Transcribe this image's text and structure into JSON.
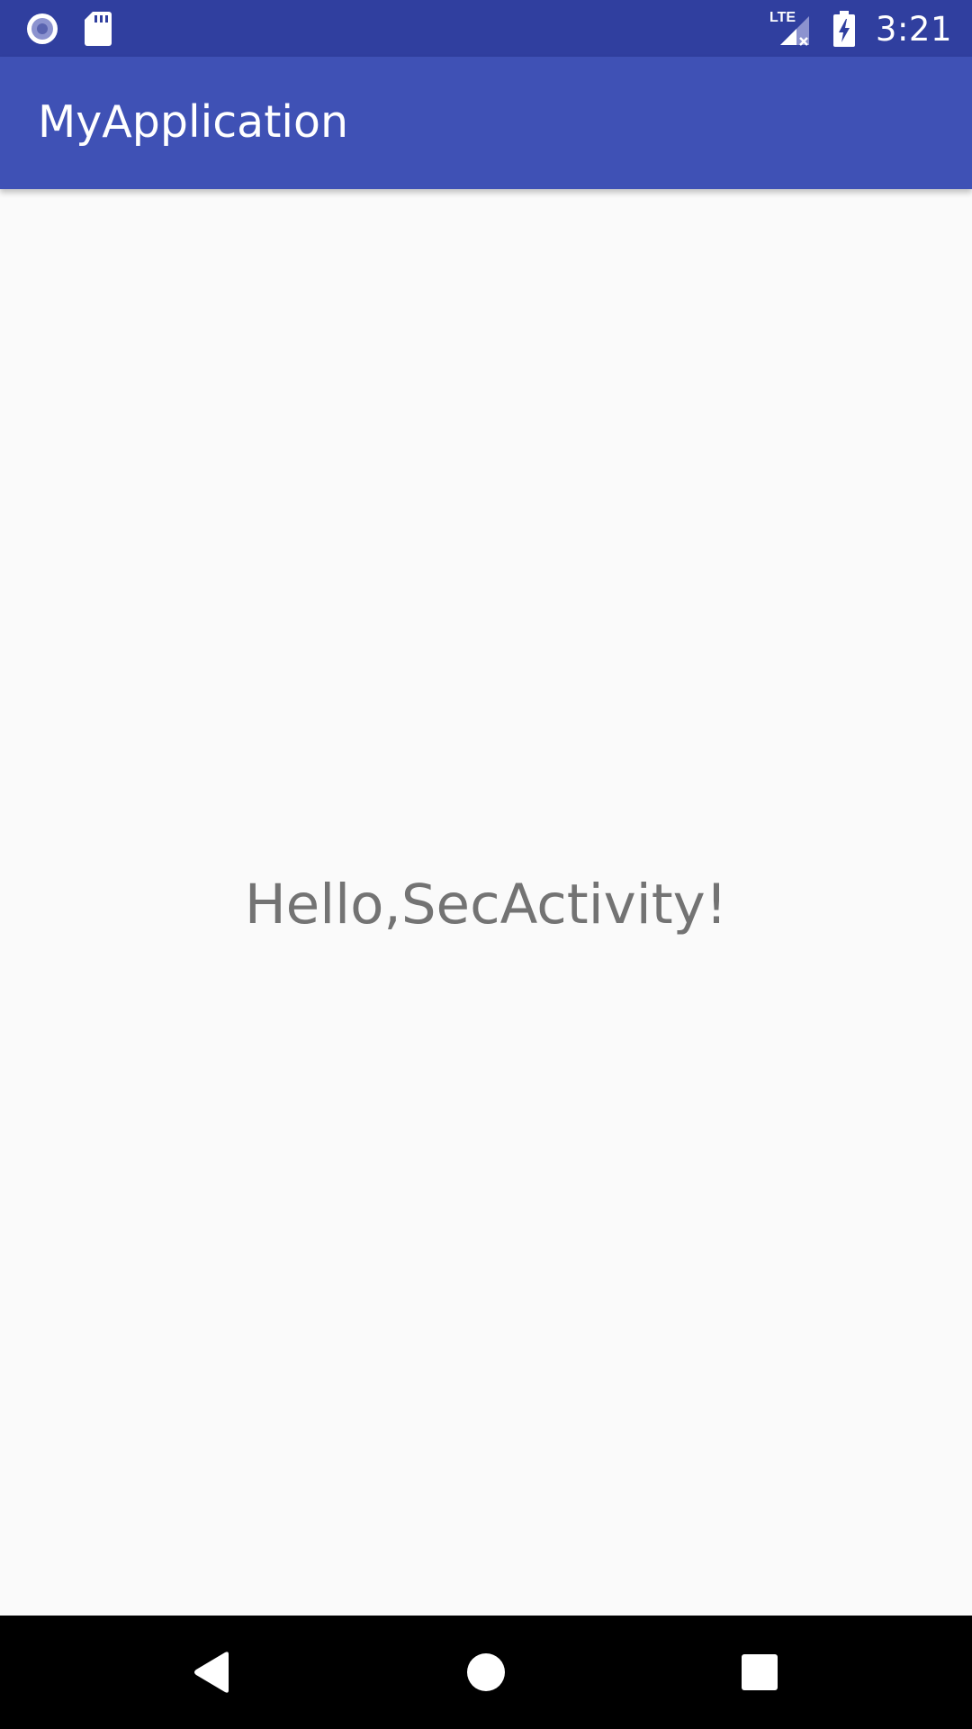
{
  "status_bar": {
    "time": "3:21",
    "network_label": "LTE",
    "icons": [
      "radio-icon",
      "sd-card-icon",
      "lte-signal-icon",
      "battery-charging-icon"
    ],
    "background": "#303F9F"
  },
  "app_bar": {
    "title": "MyApplication",
    "background": "#3F51B5"
  },
  "content": {
    "message": "Hello,SecActivity!",
    "text_color": "#737373",
    "background": "#FAFAFA"
  },
  "nav_bar": {
    "buttons": [
      "back-icon",
      "home-icon",
      "recents-icon"
    ],
    "background": "#000000"
  }
}
